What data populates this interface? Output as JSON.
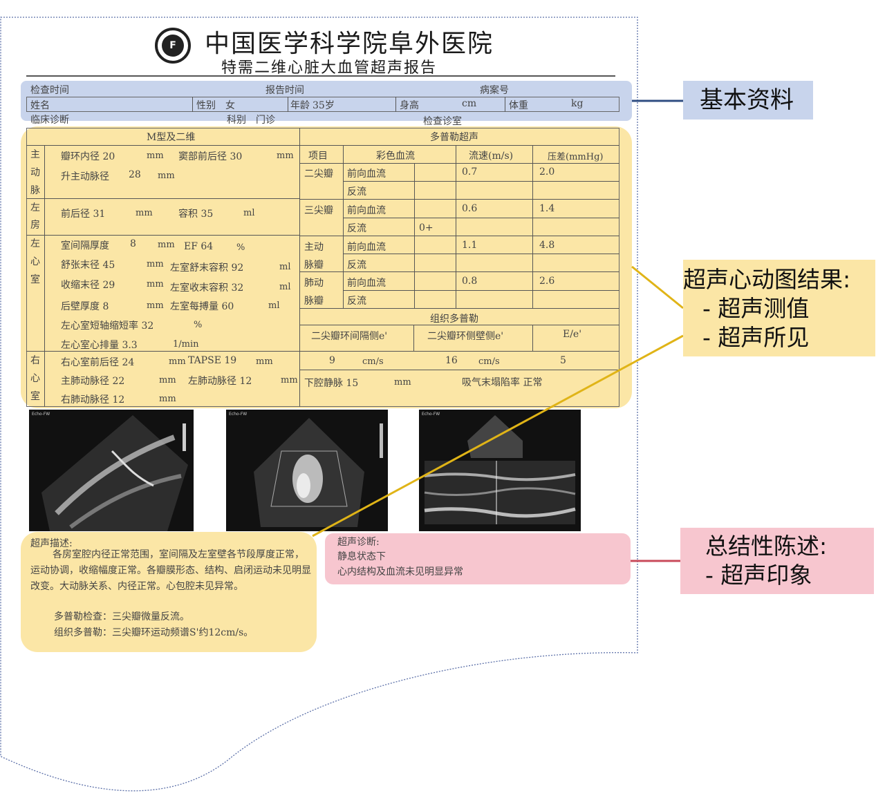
{
  "header": {
    "hospital": "中国医学科学院阜外医院",
    "report_title": "特需二维心脏大血管超声报告",
    "logo_text": "F"
  },
  "basic": {
    "exam_time_label": "检查时间",
    "report_time_label": "报告时间",
    "case_no_label": "病案号",
    "name_label": "姓名",
    "sex_label": "性别",
    "sex_value": "女",
    "age_label": "年龄",
    "age_value": "35岁",
    "height_label": "身高",
    "height_unit": "cm",
    "weight_label": "体重",
    "weight_unit": "kg",
    "clinical_dx_label": "临床诊断",
    "dept_label": "科别",
    "dept_value": "门诊",
    "exam_room": "检查诊室"
  },
  "mmode": {
    "header": "M型及二维",
    "aorta": {
      "label": [
        "主",
        "动",
        "脉"
      ],
      "annulus": "瓣环内径 20",
      "annulus_unit": "mm",
      "sinus": "窦部前后径 30",
      "sinus_unit": "mm",
      "ascending": "升主动脉径",
      "ascending_val": "28",
      "ascending_unit": "mm"
    },
    "la": {
      "label": [
        "左",
        "房"
      ],
      "ap": "前后径 31",
      "ap_unit": "mm",
      "vol": "容积 35",
      "vol_unit": "ml"
    },
    "lv": {
      "label": [
        "左",
        "心",
        "室"
      ],
      "ivs": "室间隔厚度",
      "ivs_val": "8",
      "ivs_unit": "mm",
      "ef": "EF 64",
      "ef_unit": "%",
      "lvedd": "舒张末径 45",
      "lvedd_unit": "mm",
      "edv": "左室舒末容积 92",
      "edv_unit": "ml",
      "lvesd": "收缩末径 29",
      "lvesd_unit": "mm",
      "esv": "左室收末容积 32",
      "esv_unit": "ml",
      "pw": "后壁厚度 8",
      "pw_unit": "mm",
      "sv": "左室每搏量 60",
      "sv_unit": "ml",
      "fs": "左心室短轴缩短率 32",
      "fs_unit": "%",
      "co": "左心室心排量 3.3",
      "co_unit": "1/min"
    },
    "rv": {
      "label": [
        "右",
        "心",
        "室"
      ],
      "rvd": "右心室前后径 24",
      "rvd_unit": "mm",
      "tapse": "TAPSE 19",
      "tapse_unit": "mm",
      "mpa": "主肺动脉径 22",
      "mpa_unit": "mm",
      "lpa": "左肺动脉径 12",
      "lpa_unit": "mm",
      "rpa": "右肺动脉径 12",
      "rpa_unit": "mm"
    }
  },
  "doppler": {
    "header": "多普勒超声",
    "col_item": "项目",
    "col_color": "彩色血流",
    "col_velocity": "流速(m/s)",
    "col_gradient": "压差(mmHg)",
    "rows": [
      {
        "valve": "二尖瓣",
        "flow": "前向血流",
        "grade": "",
        "velocity": "0.7",
        "gradient": "2.0"
      },
      {
        "valve": "",
        "flow": "反流",
        "grade": "",
        "velocity": "",
        "gradient": ""
      },
      {
        "valve": "三尖瓣",
        "flow": "前向血流",
        "grade": "",
        "velocity": "0.6",
        "gradient": "1.4"
      },
      {
        "valve": "",
        "flow": "反流",
        "grade": "0+",
        "velocity": "",
        "gradient": ""
      },
      {
        "valve": "主动",
        "flow": "前向血流",
        "grade": "",
        "velocity": "1.1",
        "gradient": "4.8"
      },
      {
        "valve": "脉瓣",
        "flow": "反流",
        "grade": "",
        "velocity": "",
        "gradient": ""
      },
      {
        "valve": "肺动",
        "flow": "前向血流",
        "grade": "",
        "velocity": "0.8",
        "gradient": "2.6"
      },
      {
        "valve": "脉瓣",
        "flow": "反流",
        "grade": "",
        "velocity": "",
        "gradient": ""
      }
    ],
    "tdi_header": "组织多普勒",
    "tdi_septal": "二尖瓣环间隔侧e'",
    "tdi_lateral": "二尖瓣环侧壁侧e'",
    "tdi_ee": "E/e'",
    "tdi_septal_val": "9",
    "tdi_septal_unit": "cm/s",
    "tdi_lateral_val": "16",
    "tdi_lateral_unit": "cm/s",
    "tdi_ee_val": "5",
    "ivc": "下腔静脉 15",
    "ivc_unit": "mm",
    "collapse": "吸气末塌陷率 正常"
  },
  "scans": {
    "s1": "Echo-FW",
    "s2": "Echo-FW",
    "s3": "Echo-FW"
  },
  "description": {
    "label": "超声描述:",
    "p1": "各房室腔内径正常范围，室间隔及左室壁各节段厚度正常，运动协调，收缩幅度正常。各瓣膜形态、结构、启闭运动未见明显改变。大动脉关系、内径正常。心包腔未见异常。",
    "p2": "多普勒检查：三尖瓣微量反流。",
    "p3": "组织多普勒：三尖瓣环运动频谱S'约12cm/s。"
  },
  "diagnosis": {
    "label": "超声诊断:",
    "l1": "静息状态下",
    "l2": "心内结构及血流未见明显异常"
  },
  "callouts": {
    "basic": "基本资料",
    "echo_title": "超声心动图结果:",
    "echo_b1": "- 超声测值",
    "echo_b2": "- 超声所见",
    "summary_title": "总结性陈述:",
    "summary_b1": "- 超声印象"
  },
  "colors": {
    "blue": "#c8d4ec",
    "yellow": "#fbe6a6",
    "pink": "#f7c6cf",
    "blue_line": "#2f4d82",
    "yellow_line": "#e0b417",
    "pink_line": "#c94a5a"
  }
}
